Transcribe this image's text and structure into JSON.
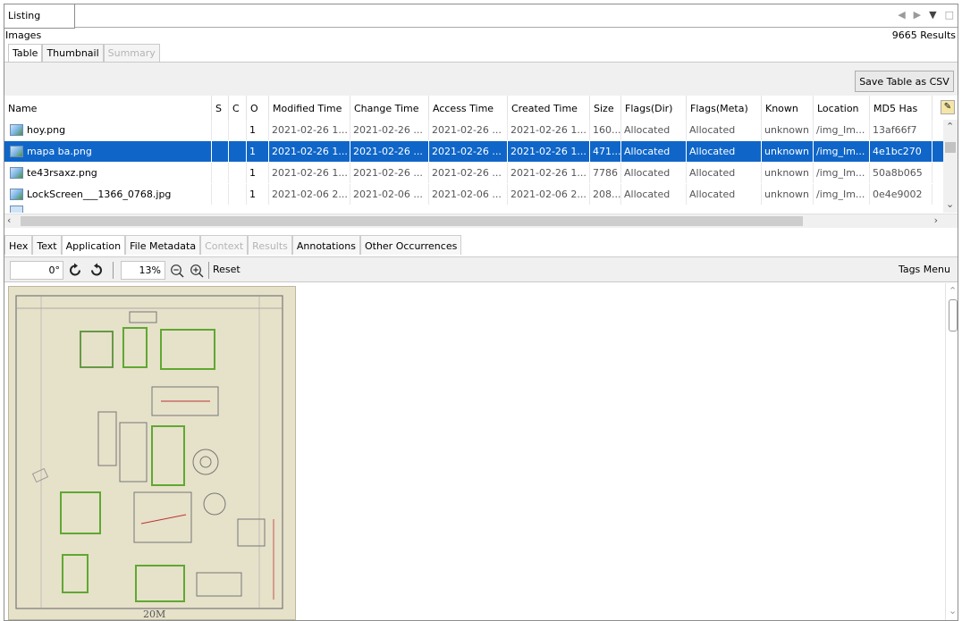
{
  "listing_tab": "Listing",
  "header": {
    "section": "Images",
    "results": "9665 Results"
  },
  "view_tabs": [
    {
      "label": "Table",
      "state": "active"
    },
    {
      "label": "Thumbnail",
      "state": "normal"
    },
    {
      "label": "Summary",
      "state": "disabled"
    }
  ],
  "save_csv_label": "Save Table as CSV",
  "columns": [
    "Name",
    "S",
    "C",
    "O",
    "Modified Time",
    "Change Time",
    "Access Time",
    "Created Time",
    "Size",
    "Flags(Dir)",
    "Flags(Meta)",
    "Known",
    "Location",
    "MD5 Has"
  ],
  "rows": [
    {
      "name": "hoy.png",
      "o": "1",
      "modified": "2021-02-26 1...",
      "change": "2021-02-26 ...",
      "access": "2021-02-26 ...",
      "created": "2021-02-26 1...",
      "size": "160...",
      "flags_dir": "Allocated",
      "flags_meta": "Allocated",
      "known": "unknown",
      "location": "/img_Im...",
      "md5": "13af66f7"
    },
    {
      "name": "mapa ba.png",
      "o": "1",
      "modified": "2021-02-26 1...",
      "change": "2021-02-26 ...",
      "access": "2021-02-26 ...",
      "created": "2021-02-26 1...",
      "size": "471...",
      "flags_dir": "Allocated",
      "flags_meta": "Allocated",
      "known": "unknown",
      "location": "/img_Im...",
      "md5": "4e1bc270"
    },
    {
      "name": "te43rsaxz.png",
      "o": "1",
      "modified": "2021-02-26 1...",
      "change": "2021-02-26 ...",
      "access": "2021-02-26 ...",
      "created": "2021-02-26 1...",
      "size": "7786",
      "flags_dir": "Allocated",
      "flags_meta": "Allocated",
      "known": "unknown",
      "location": "/img_Im...",
      "md5": "50a8b065"
    },
    {
      "name": "LockScreen___1366_0768.jpg",
      "o": "1",
      "modified": "2021-02-06 2...",
      "change": "2021-02-06 ...",
      "access": "2021-02-06 ...",
      "created": "2021-02-06 2...",
      "size": "208...",
      "flags_dir": "Allocated",
      "flags_meta": "Allocated",
      "known": "unknown",
      "location": "/img_Im...",
      "md5": "0e4e9002"
    }
  ],
  "content_tabs": [
    {
      "label": "Hex",
      "state": "normal"
    },
    {
      "label": "Text",
      "state": "normal"
    },
    {
      "label": "Application",
      "state": "active"
    },
    {
      "label": "File Metadata",
      "state": "normal"
    },
    {
      "label": "Context",
      "state": "disabled"
    },
    {
      "label": "Results",
      "state": "disabled"
    },
    {
      "label": "Annotations",
      "state": "normal"
    },
    {
      "label": "Other Occurrences",
      "state": "normal"
    }
  ],
  "viewer": {
    "rotation": "0°",
    "zoom": "13%",
    "reset_label": "Reset",
    "tags_menu": "Tags Menu",
    "image_caption": "20M"
  },
  "colors": {
    "selection": "#0f66c8",
    "pane_bg": "#f0f0f0"
  },
  "icons": [
    "rotate-left-icon",
    "rotate-right-icon",
    "zoom-out-icon",
    "zoom-in-icon",
    "image-file-icon",
    "tag-icon"
  ]
}
